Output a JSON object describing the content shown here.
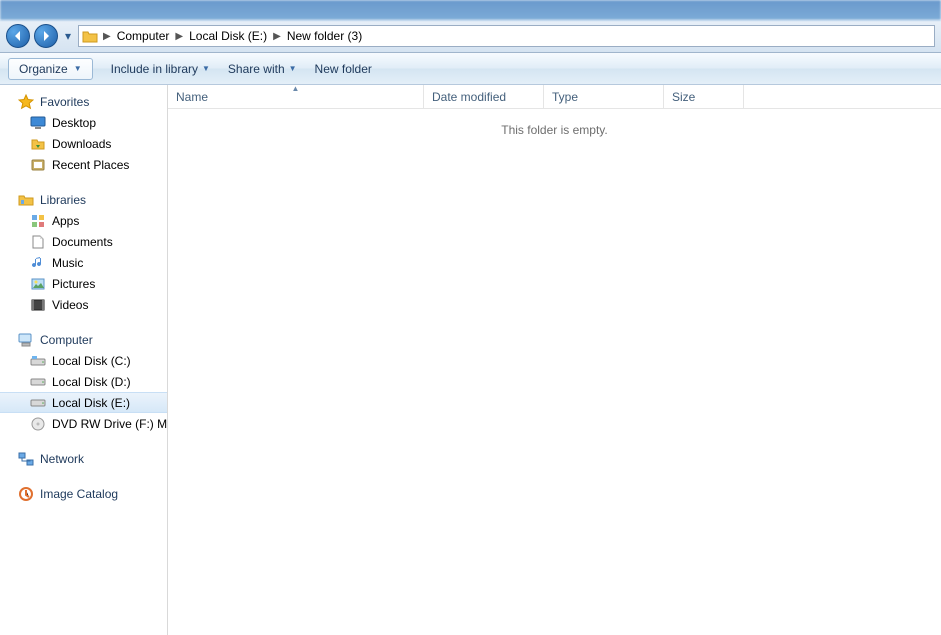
{
  "breadcrumbs": [
    "Computer",
    "Local Disk (E:)",
    "New folder (3)"
  ],
  "toolbar": {
    "organize": "Organize",
    "include": "Include in library",
    "share": "Share with",
    "new_folder": "New folder"
  },
  "sidebar": {
    "favorites": {
      "label": "Favorites",
      "items": [
        "Desktop",
        "Downloads",
        "Recent Places"
      ]
    },
    "libraries": {
      "label": "Libraries",
      "items": [
        "Apps",
        "Documents",
        "Music",
        "Pictures",
        "Videos"
      ]
    },
    "computer": {
      "label": "Computer",
      "items": [
        "Local Disk (C:)",
        "Local Disk (D:)",
        "Local Disk (E:)",
        "DVD RW Drive (F:)  M"
      ],
      "selected_index": 2
    },
    "network": {
      "label": "Network"
    },
    "image_catalog": {
      "label": "Image Catalog"
    }
  },
  "columns": {
    "name": "Name",
    "date": "Date modified",
    "type": "Type",
    "size": "Size"
  },
  "content": {
    "empty_message": "This folder is empty."
  }
}
